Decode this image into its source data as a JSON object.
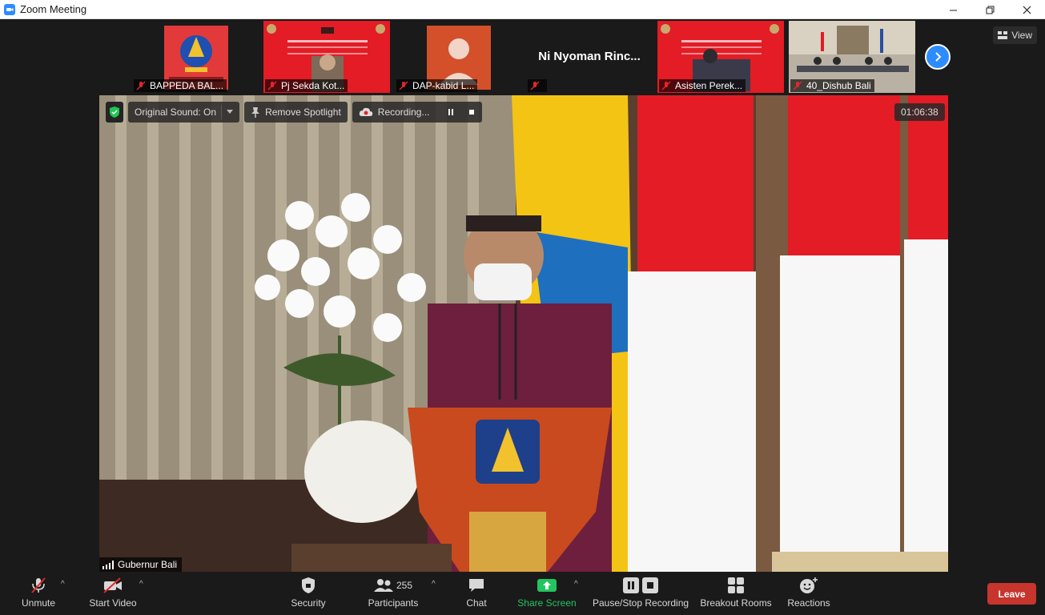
{
  "window": {
    "title": "Zoom Meeting",
    "minimize_icon": "minimize-icon",
    "restore_icon": "restore-icon",
    "close_icon": "close-icon"
  },
  "gallery": {
    "view_label": "View",
    "participants": [
      {
        "name": "BAPPEDA BAL...",
        "muted": true,
        "thumb": "logo"
      },
      {
        "name": "Pj Sekda Kot...",
        "muted": true,
        "thumb": "banner"
      },
      {
        "name": "DAP-kabid L...",
        "muted": true,
        "thumb": "avatar"
      },
      {
        "name": "Ni Nyoman Rinc...",
        "muted": true,
        "thumb": "name-only"
      },
      {
        "name": "Asisten Perek...",
        "muted": true,
        "thumb": "banner"
      },
      {
        "name": "40_Dishub Bali",
        "muted": true,
        "thumb": "room"
      }
    ]
  },
  "video_overlay": {
    "original_sound": "Original Sound: On",
    "remove_spotlight": "Remove Spotlight",
    "recording": "Recording...",
    "elapsed": "01:06:38",
    "active_speaker": "Gubernur Bali"
  },
  "toolbar": {
    "unmute": "Unmute",
    "start_video": "Start Video",
    "security": "Security",
    "participants": "Participants",
    "participants_count": "255",
    "chat": "Chat",
    "share_screen": "Share Screen",
    "pause_stop_recording": "Pause/Stop Recording",
    "breakout_rooms": "Breakout Rooms",
    "reactions": "Reactions",
    "leave": "Leave"
  },
  "colors": {
    "accent": "#2d8cff",
    "share": "#22c55e",
    "leave": "#c7352d",
    "mute_red": "#e02828"
  }
}
